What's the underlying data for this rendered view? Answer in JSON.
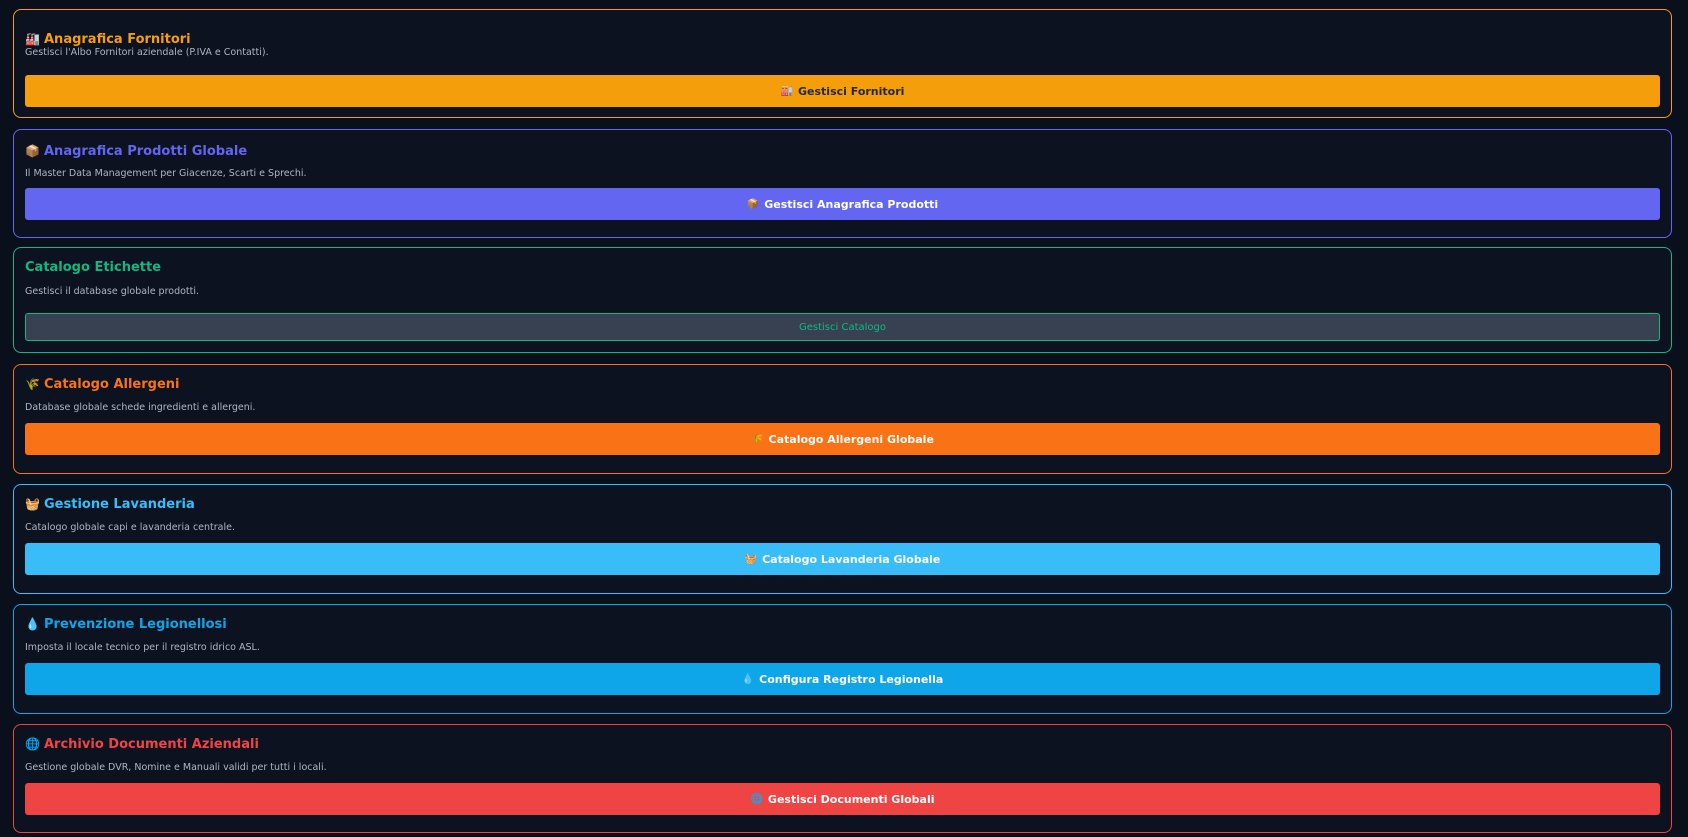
{
  "cards": [
    {
      "id": "fornitori",
      "title": "Anagrafica Fornitori",
      "icon": "factory-icon",
      "description": "Gestisci l'Albo Fornitori aziendale (P.IVA e Contatti).",
      "button_label": "Gestisci Fornitori",
      "button_icon": "factory-icon",
      "accent_color": "#f59e0b",
      "button_color": "#f59e0b",
      "button_text_color": "#1f2937"
    },
    {
      "id": "prodotti",
      "title": "Anagrafica Prodotti Globale",
      "icon": "package-icon",
      "description": "Il Master Data Management per Giacenze, Scarti e Sprechi.",
      "button_label": "Gestisci Anagrafica Prodotti",
      "button_icon": "package-icon",
      "accent_color": "#6366f1",
      "button_color": "#6366f1",
      "button_text_color": "#ffffff"
    },
    {
      "id": "etichette",
      "title": "Catalogo Etichette",
      "icon": "",
      "description": "Gestisci il database globale prodotti.",
      "button_label": "Gestisci Catalogo",
      "button_icon": "",
      "accent_color": "#10b981",
      "button_color": "#374151",
      "button_text_color": "#10b981"
    },
    {
      "id": "allergeni",
      "title": "Catalogo Allergeni",
      "icon": "wheat-icon",
      "description": "Database globale schede ingredienti e allergeni.",
      "button_label": "Catalogo Allergeni Globale",
      "button_icon": "wheat-icon",
      "accent_color": "#f97316",
      "button_color": "#f97316",
      "button_text_color": "#ffffff"
    },
    {
      "id": "lavanderia",
      "title": "Gestione Lavanderia",
      "icon": "basket-icon",
      "description": "Catalogo globale capi e lavanderia centrale.",
      "button_label": "Catalogo Lavanderia Globale",
      "button_icon": "basket-icon",
      "accent_color": "#38bdf8",
      "button_color": "#38bdf8",
      "button_text_color": "#ffffff"
    },
    {
      "id": "legionella",
      "title": "Prevenzione Legionellosi",
      "icon": "water-drop-icon",
      "description": "Imposta il locale tecnico per il registro idrico ASL.",
      "button_label": "Configura Registro Legionella",
      "button_icon": "water-drop-icon",
      "accent_color": "#0ea5e9",
      "button_color": "#0ea5e9",
      "button_text_color": "#ffffff"
    },
    {
      "id": "documenti",
      "title": "Archivio Documenti Aziendali",
      "icon": "globe-icon",
      "description": "Gestione globale DVR, Nomine e Manuali validi per tutti i locali.",
      "button_label": "Gestisci Documenti Globali",
      "button_icon": "globe-icon",
      "accent_color": "#ef4444",
      "button_color": "#ef4444",
      "button_text_color": "#ffffff"
    }
  ]
}
